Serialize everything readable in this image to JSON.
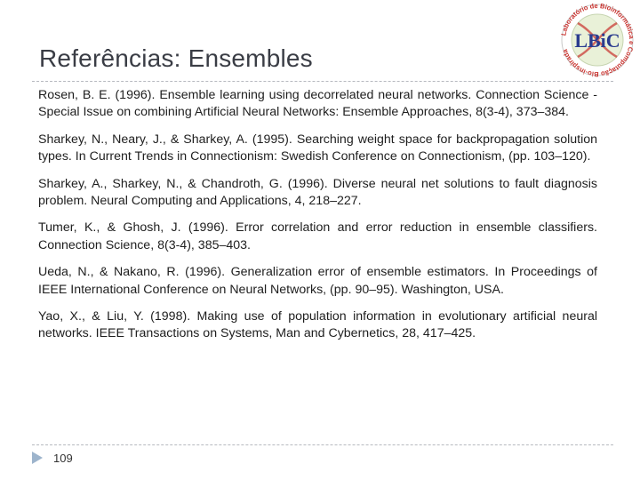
{
  "slide": {
    "title": "Referências: Ensembles",
    "page_number": "109",
    "logo": {
      "text": "LBiC",
      "ring_text": "Laboratório de Bioinformática e Computação Bio-inspirada",
      "colors": {
        "text": "#2a3b8f",
        "ring": "#c8302c",
        "bg": "#e9f1d8"
      }
    },
    "references": [
      "Rosen, B. E. (1996). Ensemble learning using decorrelated neural networks. Connection Science - Special Issue on combining Artificial Neural Networks: Ensemble Approaches, 8(3-4), 373–384.",
      "Sharkey, N., Neary, J., & Sharkey, A. (1995). Searching weight space for backpropagation solution types. In Current Trends in Connectionism: Swedish Conference on Connectionism, (pp. 103–120).",
      "Sharkey, A., Sharkey, N., & Chandroth, G. (1996). Diverse neural net solutions to fault diagnosis problem. Neural Computing and Applications, 4, 218–227.",
      "Tumer, K., & Ghosh, J. (1996). Error correlation and error reduction in ensemble classifiers. Connection Science, 8(3-4), 385–403.",
      "Ueda, N., & Nakano, R. (1996). Generalization error of ensemble estimators. In Proceedings of IEEE International Conference on Neural Networks, (pp. 90–95). Washington, USA.",
      "Yao, X., & Liu, Y. (1998). Making use of population information in evolutionary artificial neural networks. IEEE Transactions on Systems, Man and Cybernetics, 28, 417–425."
    ]
  }
}
